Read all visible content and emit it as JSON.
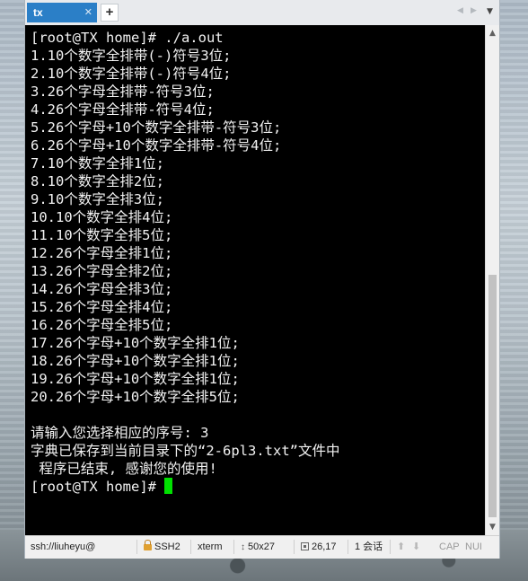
{
  "tabbar": {
    "tab_label": "tx",
    "close_glyph": "✕",
    "add_glyph": "+",
    "nav_left_glyph": "◀",
    "nav_right_glyph": "▶",
    "menu_glyph": "▼"
  },
  "terminal": {
    "lines": [
      "[root@TX home]# ./a.out",
      "1.10个数字全排带(-)符号3位;",
      "2.10个数字全排带(-)符号4位;",
      "3.26个字母全排带-符号3位;",
      "4.26个字母全排带-符号4位;",
      "5.26个字母+10个数字全排带-符号3位;",
      "6.26个字母+10个数字全排带-符号4位;",
      "7.10个数字全排1位;",
      "8.10个数字全排2位;",
      "9.10个数字全排3位;",
      "10.10个数字全排4位;",
      "11.10个数字全排5位;",
      "12.26个字母全排1位;",
      "13.26个字母全排2位;",
      "14.26个字母全排3位;",
      "15.26个字母全排4位;",
      "16.26个字母全排5位;",
      "17.26个字母+10个数字全排1位;",
      "18.26个字母+10个数字全排1位;",
      "19.26个字母+10个数字全排1位;",
      "20.26个字母+10个数字全排5位;",
      "",
      "请输入您选择相应的序号: 3",
      "字典已保存到当前目录下的“2-6pl3.txt”文件中",
      " 程序已结束, 感谢您的使用!",
      "[root@TX home]# "
    ],
    "cursor_color": "#00e000",
    "text_color": "#f2f2f2",
    "background": "#000000"
  },
  "scrollbar": {
    "up_glyph": "▲",
    "down_glyph": "▼"
  },
  "statusbar": {
    "connection": "ssh://liuheyu@",
    "protocol": "SSH2",
    "terminal_type": "xterm",
    "size": "50x27",
    "cursor_position": "26,17",
    "sessions": "1 会话",
    "up_glyph": "⬆",
    "down_glyph": "⬇",
    "caps": "CAP",
    "num": "NUI"
  },
  "colors": {
    "tab_active": "#2b7fc7",
    "lock_icon": "#e0a030"
  }
}
